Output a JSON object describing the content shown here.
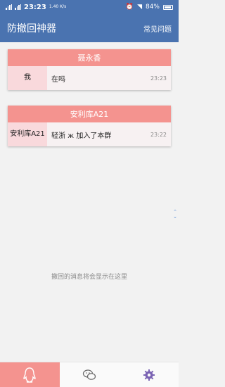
{
  "status_bar": {
    "time": "23:23",
    "net_speed": "1.40 K/s",
    "battery": "84%"
  },
  "header": {
    "title": "防撤回神器",
    "help_link": "常见问题"
  },
  "groups": [
    {
      "name": "聂永香",
      "messages": [
        {
          "sender": "我",
          "text": "在吗",
          "time": "23:23"
        }
      ]
    },
    {
      "name": "安利库A21",
      "messages": [
        {
          "sender": "安利库A21",
          "text": "轻浙 ж 加入了本群",
          "time": "23:22"
        }
      ]
    }
  ],
  "empty_hint": "撤回的消息将会显示在这里",
  "bottom_nav": {
    "items": [
      {
        "icon": "qq-penguin-icon",
        "active": true
      },
      {
        "icon": "wechat-icon",
        "active": false
      },
      {
        "icon": "gear-icon",
        "active": false
      }
    ]
  },
  "colors": {
    "primary": "#4a73b0",
    "accent": "#f4938f",
    "sender_bg": "#f9d9dc"
  }
}
